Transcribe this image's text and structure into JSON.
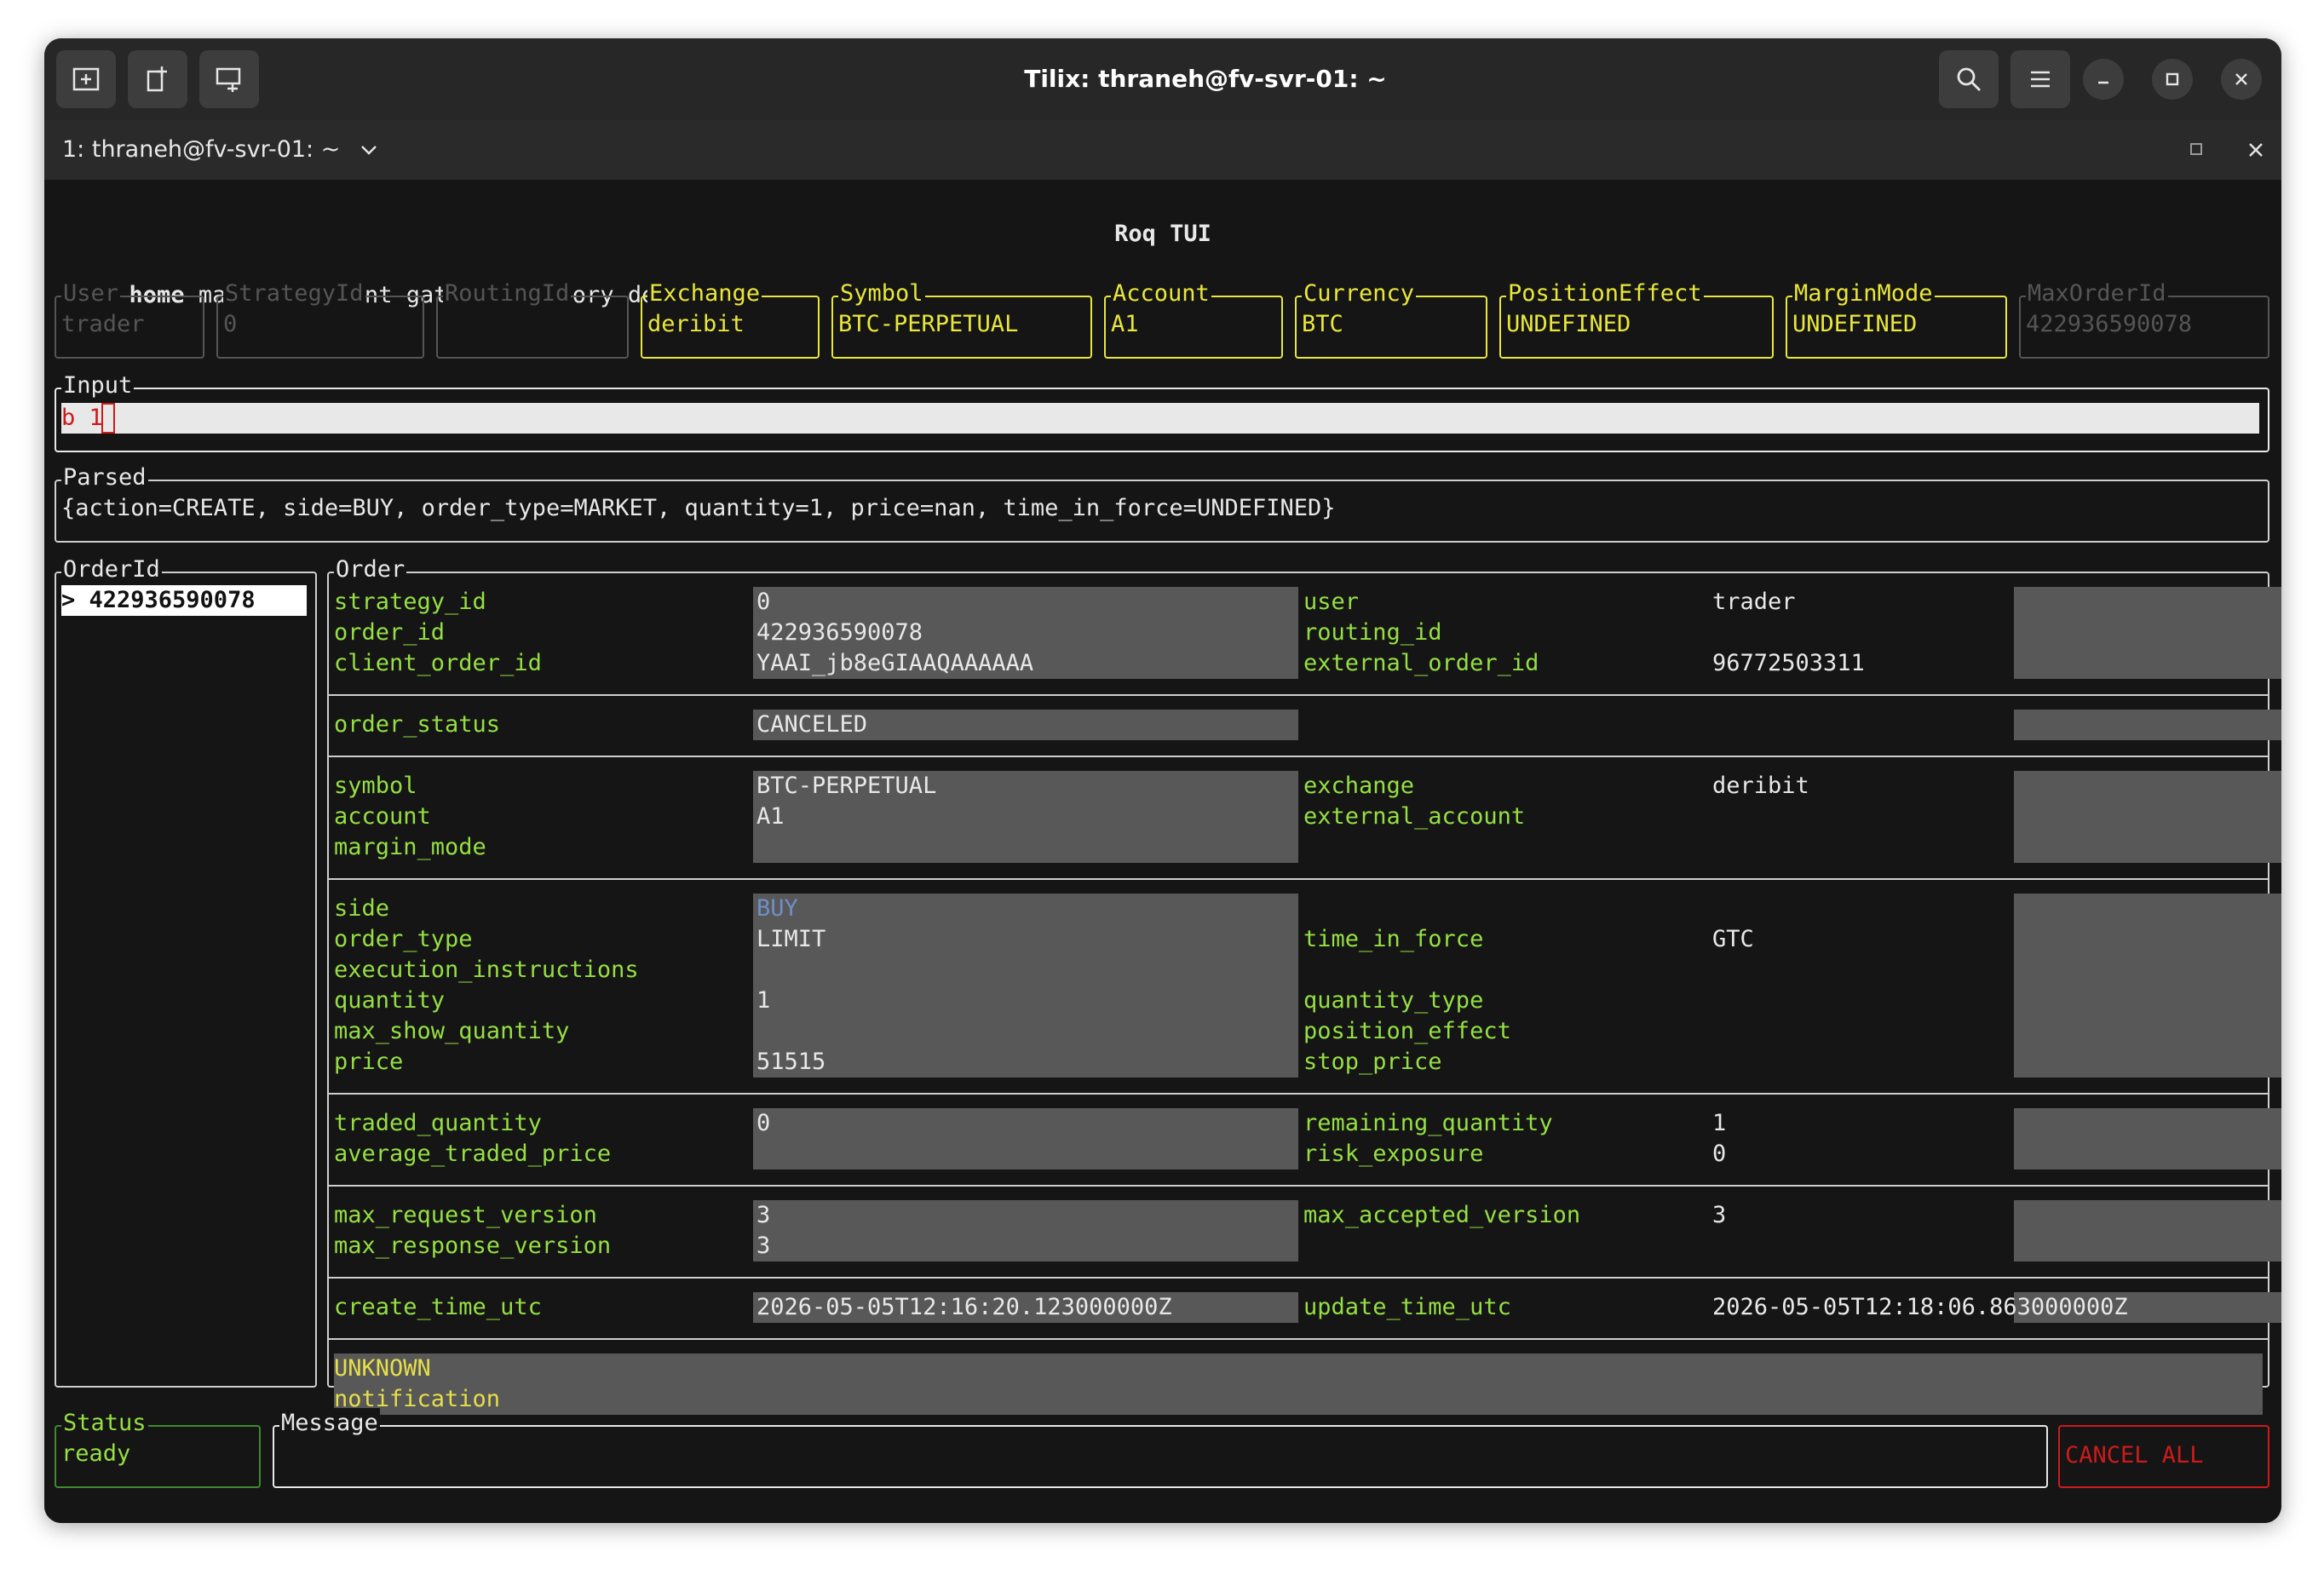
{
  "window": {
    "title": "Tilix: thraneh@fv-svr-01: ~",
    "tab_label": "1: thraneh@fv-svr-01: ~"
  },
  "app": {
    "title": "Roq TUI",
    "menu": [
      "home",
      "market",
      "account",
      "gateway",
      "history",
      "debug"
    ],
    "active_menu": "home"
  },
  "fields": [
    {
      "label": "User",
      "value": "trader",
      "state": "disabled"
    },
    {
      "label": "StrategyId",
      "value": "0",
      "state": "disabled"
    },
    {
      "label": "RoutingId",
      "value": "",
      "state": "disabled"
    },
    {
      "label": "Exchange",
      "value": "deribit",
      "state": "active"
    },
    {
      "label": "Symbol",
      "value": "BTC-PERPETUAL",
      "state": "active"
    },
    {
      "label": "Account",
      "value": "A1",
      "state": "active"
    },
    {
      "label": "Currency",
      "value": "BTC",
      "state": "active"
    },
    {
      "label": "PositionEffect",
      "value": "UNDEFINED",
      "state": "active"
    },
    {
      "label": "MarginMode",
      "value": "UNDEFINED",
      "state": "active"
    },
    {
      "label": "MaxOrderId",
      "value": "422936590078",
      "state": "disabled"
    }
  ],
  "input": {
    "label": "Input",
    "value": "b 1"
  },
  "parsed": {
    "label": "Parsed",
    "value": "{action=CREATE, side=BUY, order_type=MARKET, quantity=1, price=nan, time_in_force=UNDEFINED}"
  },
  "order_ids": {
    "label": "OrderId",
    "items": [
      "> 422936590078"
    ]
  },
  "order": {
    "label": "Order",
    "sections": [
      {
        "left_keys": [
          "strategy_id",
          "order_id",
          "client_order_id"
        ],
        "left_vals": [
          "0",
          "422936590078",
          "YAAI_jb8eGIAAQAAAAAA"
        ],
        "right_keys": [
          "user",
          "routing_id",
          "external_order_id"
        ],
        "right_vals": [
          "trader",
          "",
          "96772503311"
        ]
      },
      {
        "left_keys": [
          "order_status"
        ],
        "left_vals": [
          "CANCELED"
        ],
        "right_keys": [
          ""
        ],
        "right_vals": [
          ""
        ]
      },
      {
        "left_keys": [
          "symbol",
          "account",
          "margin_mode"
        ],
        "left_vals": [
          "BTC-PERPETUAL",
          "A1",
          ""
        ],
        "right_keys": [
          "exchange",
          "external_account",
          ""
        ],
        "right_vals": [
          "deribit",
          "",
          ""
        ]
      },
      {
        "left_keys": [
          "side",
          "order_type",
          "execution_instructions",
          "quantity",
          "max_show_quantity",
          "price"
        ],
        "left_vals": [
          "BUY",
          "LIMIT",
          "",
          "1",
          "",
          "51515"
        ],
        "right_keys": [
          "",
          "time_in_force",
          "",
          "quantity_type",
          "position_effect",
          "stop_price"
        ],
        "right_vals": [
          "",
          "GTC",
          "",
          "",
          "",
          ""
        ]
      },
      {
        "left_keys": [
          "traded_quantity",
          "average_traded_price"
        ],
        "left_vals": [
          "0",
          ""
        ],
        "right_keys": [
          "remaining_quantity",
          "risk_exposure"
        ],
        "right_vals": [
          "1",
          "0"
        ]
      },
      {
        "left_keys": [
          "max_request_version",
          "max_response_version"
        ],
        "left_vals": [
          "3",
          "3"
        ],
        "right_keys": [
          "max_accepted_version",
          ""
        ],
        "right_vals": [
          "3",
          ""
        ]
      },
      {
        "left_keys": [
          "create_time_utc"
        ],
        "left_vals": [
          "2026-05-05T12:16:20.123000000Z"
        ],
        "right_keys": [
          "update_time_utc"
        ],
        "right_vals": [
          "2026-05-05T12:18:06.863000000Z"
        ]
      }
    ],
    "notification": [
      "UNKNOWN",
      "notification"
    ]
  },
  "status": {
    "label": "Status",
    "value": "ready"
  },
  "message": {
    "label": "Message",
    "value": ""
  },
  "cancel_all": {
    "label": "CANCEL ALL"
  },
  "colors": {
    "label_green": "#95df43",
    "active_yellow": "#e9e73a",
    "disabled_gray": "#555555",
    "side_buy_blue": "#6f8fc8",
    "error_red": "#cc1b1b",
    "notification_yellow": "#e5df4a",
    "value_cell_bg": "#585858"
  }
}
